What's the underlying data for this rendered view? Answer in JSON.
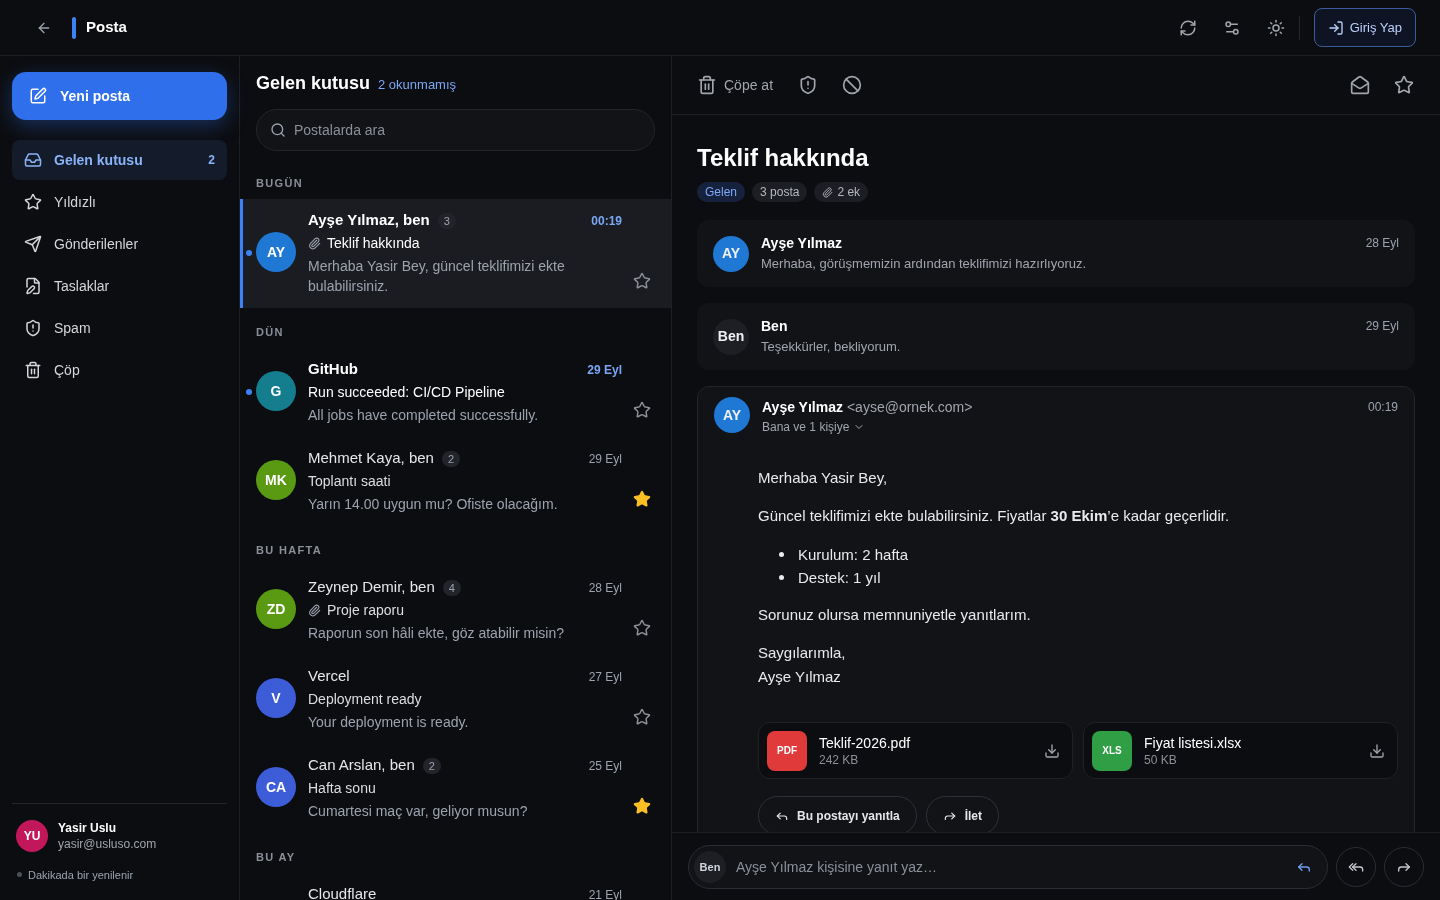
{
  "header": {
    "title": "Posta",
    "login_button": "Giriş Yap"
  },
  "sidebar": {
    "compose_button": "Yeni posta",
    "items": [
      {
        "kind": "inbox",
        "label": "Gelen kutusu",
        "count": "2",
        "selected": true
      },
      {
        "kind": "starred",
        "label": "Yıldızlı",
        "selected": false
      },
      {
        "kind": "sent",
        "label": "Gönderilenler",
        "selected": false
      },
      {
        "kind": "drafts",
        "label": "Taslaklar",
        "selected": false
      },
      {
        "kind": "spam",
        "label": "Spam",
        "selected": false
      },
      {
        "kind": "trash",
        "label": "Çöp",
        "selected": false
      }
    ],
    "user": {
      "initials": "YU",
      "name": "Yasir Uslu",
      "email": "yasir@usluso.com"
    },
    "status": "Dakikada bir yenilenir"
  },
  "mail_list": {
    "title": "Gelen kutusu",
    "unread_summary": "2 okunmamış",
    "search": {
      "placeholder": "Postalarda ara"
    },
    "groups": [
      {
        "label": "BUGÜN",
        "items": [
          {
            "initials": "AY",
            "color": "#1e78d4",
            "sender": "Ayşe Yılmaz, ben",
            "thread_count": "3",
            "time": "00:19",
            "subject": "Teklif hakkında",
            "attachment": true,
            "preview": "Merhaba Yasir Bey, güncel teklifimizi ekte bulabilirsiniz.",
            "unread": true,
            "selected": true,
            "starred": false
          }
        ]
      },
      {
        "label": "DÜN",
        "items": [
          {
            "initials": "G",
            "color": "#147d8e",
            "sender": "GitHub",
            "time": "29 Eyl",
            "subject": "Run succeeded: CI/CD Pipeline",
            "attachment": false,
            "preview": "All jobs have completed successfully.",
            "unread": true,
            "selected": false,
            "starred": false
          },
          {
            "initials": "MK",
            "color": "#5a9a12",
            "sender": "Mehmet Kaya, ben",
            "thread_count": "2",
            "time": "29 Eyl",
            "subject": "Toplantı saati",
            "attachment": false,
            "preview": "Yarın 14.00 uygun mu? Ofiste olacağım.",
            "unread": false,
            "selected": false,
            "starred": true
          }
        ]
      },
      {
        "label": "BU HAFTA",
        "items": [
          {
            "initials": "ZD",
            "color": "#5a9a12",
            "sender": "Zeynep Demir, ben",
            "thread_count": "4",
            "time": "28 Eyl",
            "subject": "Proje raporu",
            "attachment": true,
            "preview": "Raporun son hâli ekte, göz atabilir misin?",
            "unread": false,
            "selected": false,
            "starred": false
          },
          {
            "initials": "V",
            "color": "#3d5cd8",
            "sender": "Vercel",
            "time": "27 Eyl",
            "subject": "Deployment ready",
            "attachment": false,
            "preview": "Your deployment is ready.",
            "unread": false,
            "selected": false,
            "starred": false
          },
          {
            "initials": "CA",
            "color": "#3d5cd8",
            "sender": "Can Arslan, ben",
            "thread_count": "2",
            "time": "25 Eyl",
            "subject": "Hafta sonu",
            "attachment": false,
            "preview": "Cumartesi maç var, geliyor musun?",
            "unread": false,
            "selected": false,
            "starred": true
          }
        ]
      },
      {
        "label": "BU AY",
        "items": [
          {
            "sender": "Cloudflare",
            "time": "21 Eyl",
            "unread": false,
            "selected": false
          }
        ]
      }
    ]
  },
  "thread": {
    "toolbar": {
      "trash_label": "Çöpe at"
    },
    "title": "Teklif hakkında",
    "tags": [
      {
        "kind": "folder",
        "label": "Gelen"
      },
      {
        "kind": "count",
        "label": "3 posta"
      },
      {
        "kind": "attachments",
        "label": "2 ek"
      }
    ],
    "messages": [
      {
        "kind": "collapsed",
        "initials": "AY",
        "color": "#1e78d4",
        "sender": "Ayşe Yılmaz",
        "snippet": "Merhaba, görüşmemizin ardından teklifimizi hazırlıyoruz.",
        "date": "28 Eyl"
      },
      {
        "kind": "collapsed",
        "initials": "Ben",
        "color": "#1d1f24",
        "sender": "Ben",
        "snippet": "Teşekkürler, bekliyorum.",
        "date": "29 Eyl"
      },
      {
        "kind": "expanded",
        "initials": "AY",
        "color": "#1e78d4",
        "sender": "Ayşe Yılmaz",
        "address": "<ayse@ornek.com>",
        "recipients": "Bana ve 1 kişiye",
        "date": "00:19",
        "body": [
          {
            "kind": "paragraph",
            "text": "Merhaba Yasir Bey,"
          },
          {
            "kind": "paragraph",
            "text": "Güncel teklifimizi ekte bulabilirsiniz. Fiyatlar **30 Ekim**’e kadar geçerlidir."
          },
          {
            "kind": "list",
            "items": [
              "Kurulum: 2 hafta",
              "Destek: 1 yıl"
            ]
          },
          {
            "kind": "paragraph",
            "text": "Sorunuz olursa memnuniyetle yanıtlarım."
          },
          {
            "kind": "lines",
            "lines": [
              "Saygılarımla,",
              "Ayşe Yılmaz"
            ]
          }
        ],
        "attachments": [
          {
            "kind": "pdf",
            "badge": "PDF",
            "name": "Teklif-2026.pdf",
            "size": "242 KB"
          },
          {
            "kind": "xls",
            "badge": "XLS",
            "name": "Fiyat listesi.xlsx",
            "size": "50 KB"
          }
        ],
        "actions": [
          {
            "kind": "reply",
            "label": "Bu postayı yanıtla"
          },
          {
            "kind": "forward",
            "label": "İlet"
          }
        ]
      }
    ]
  },
  "reply_bar": {
    "avatar": "Ben",
    "placeholder": "Ayşe Yılmaz kişisine yanıt yaz…"
  }
}
